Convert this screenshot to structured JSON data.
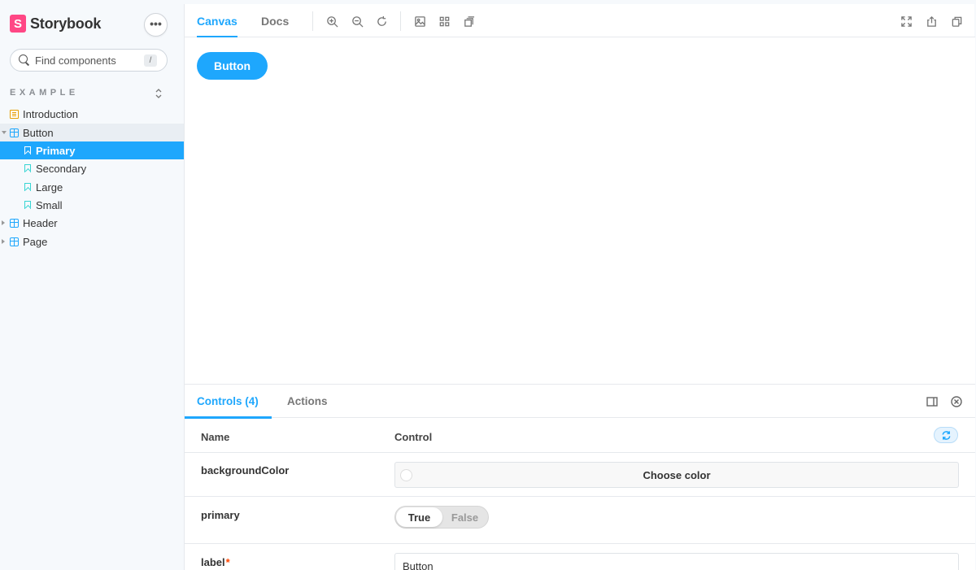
{
  "brand": {
    "logo_letter": "S",
    "name": "Storybook"
  },
  "sidebar": {
    "menu_label": "•••",
    "search_placeholder": "Find components",
    "search_shortcut": "/",
    "section_title": "EXAMPLE",
    "items": [
      {
        "label": "Introduction",
        "icon": "document-icon"
      },
      {
        "label": "Button",
        "icon": "component-icon",
        "expanded": true
      },
      {
        "label": "Primary",
        "icon": "bookmark-icon",
        "selected": true
      },
      {
        "label": "Secondary",
        "icon": "bookmark-icon"
      },
      {
        "label": "Large",
        "icon": "bookmark-icon"
      },
      {
        "label": "Small",
        "icon": "bookmark-icon"
      },
      {
        "label": "Header",
        "icon": "component-icon",
        "expanded": false
      },
      {
        "label": "Page",
        "icon": "component-icon",
        "expanded": false
      }
    ]
  },
  "toolbar": {
    "tabs": [
      {
        "label": "Canvas",
        "active": true
      },
      {
        "label": "Docs",
        "active": false
      }
    ]
  },
  "canvas": {
    "button_label": "Button"
  },
  "addons": {
    "tabs": [
      {
        "label": "Controls (4)",
        "active": true
      },
      {
        "label": "Actions",
        "active": false
      }
    ],
    "columns": {
      "name": "Name",
      "control": "Control"
    },
    "rows": {
      "backgroundColor": {
        "name": "backgroundColor",
        "control_label": "Choose color"
      },
      "primary": {
        "name": "primary",
        "true_label": "True",
        "false_label": "False",
        "value": true
      },
      "label": {
        "name": "label",
        "required_mark": "*",
        "value": "Button"
      }
    }
  },
  "colors": {
    "accent": "#1ea7fd",
    "brand": "#ff4785",
    "sidebar_bg": "#f6f9fc"
  }
}
